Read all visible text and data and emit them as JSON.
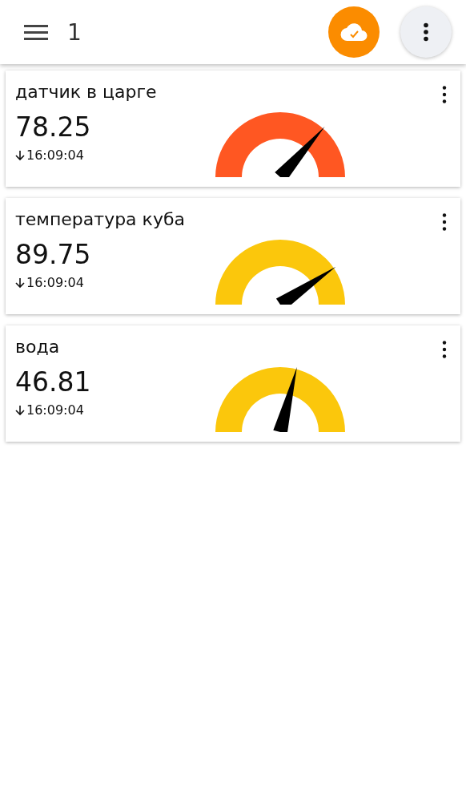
{
  "app_bar": {
    "title": "1",
    "sync_status": {
      "synced": true
    }
  },
  "widgets": [
    {
      "title": "датчик в царге",
      "value": "78.25",
      "time": "16:09:04",
      "color": "#ff5722"
    },
    {
      "title": "температура куба",
      "value": "89.75",
      "time": "16:09:04",
      "color": "#fbc70c"
    },
    {
      "title": "вода",
      "value": "46.81",
      "time": "16:09:04",
      "color": "#fbc70c"
    }
  ]
}
